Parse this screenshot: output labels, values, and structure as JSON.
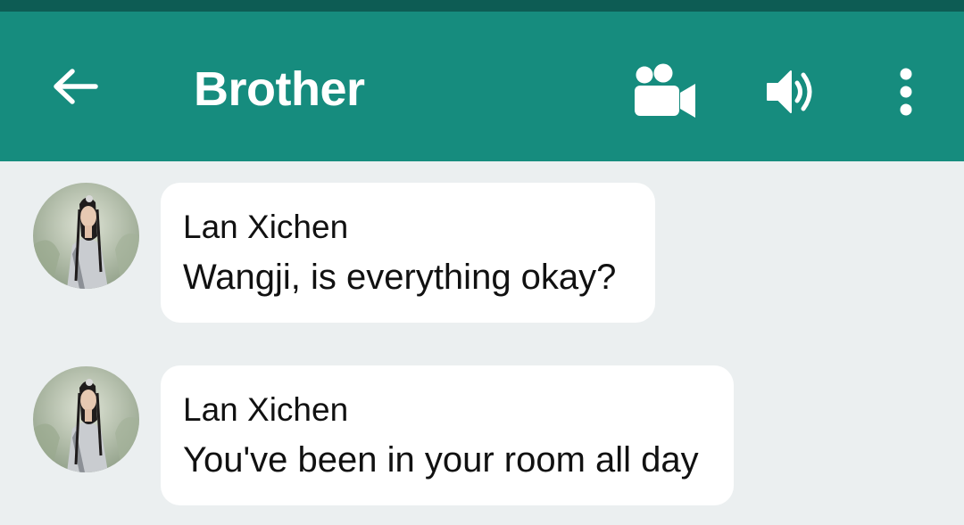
{
  "header": {
    "title": "Brother",
    "back_icon": "arrow-left-icon",
    "video_icon": "video-call-icon",
    "speaker_icon": "speaker-icon",
    "more_icon": "more-vert-icon",
    "background_color": "#168c7e",
    "status_bar_color": "#0d5c54"
  },
  "messages": [
    {
      "sender": "Lan Xichen",
      "text": "Wangji, is everything okay?",
      "avatar": "contact-avatar"
    },
    {
      "sender": "Lan Xichen",
      "text": "You've been in your room all day",
      "avatar": "contact-avatar"
    }
  ],
  "colors": {
    "chat_background": "#ebeff0",
    "bubble": "#ffffff",
    "text": "#111111"
  }
}
